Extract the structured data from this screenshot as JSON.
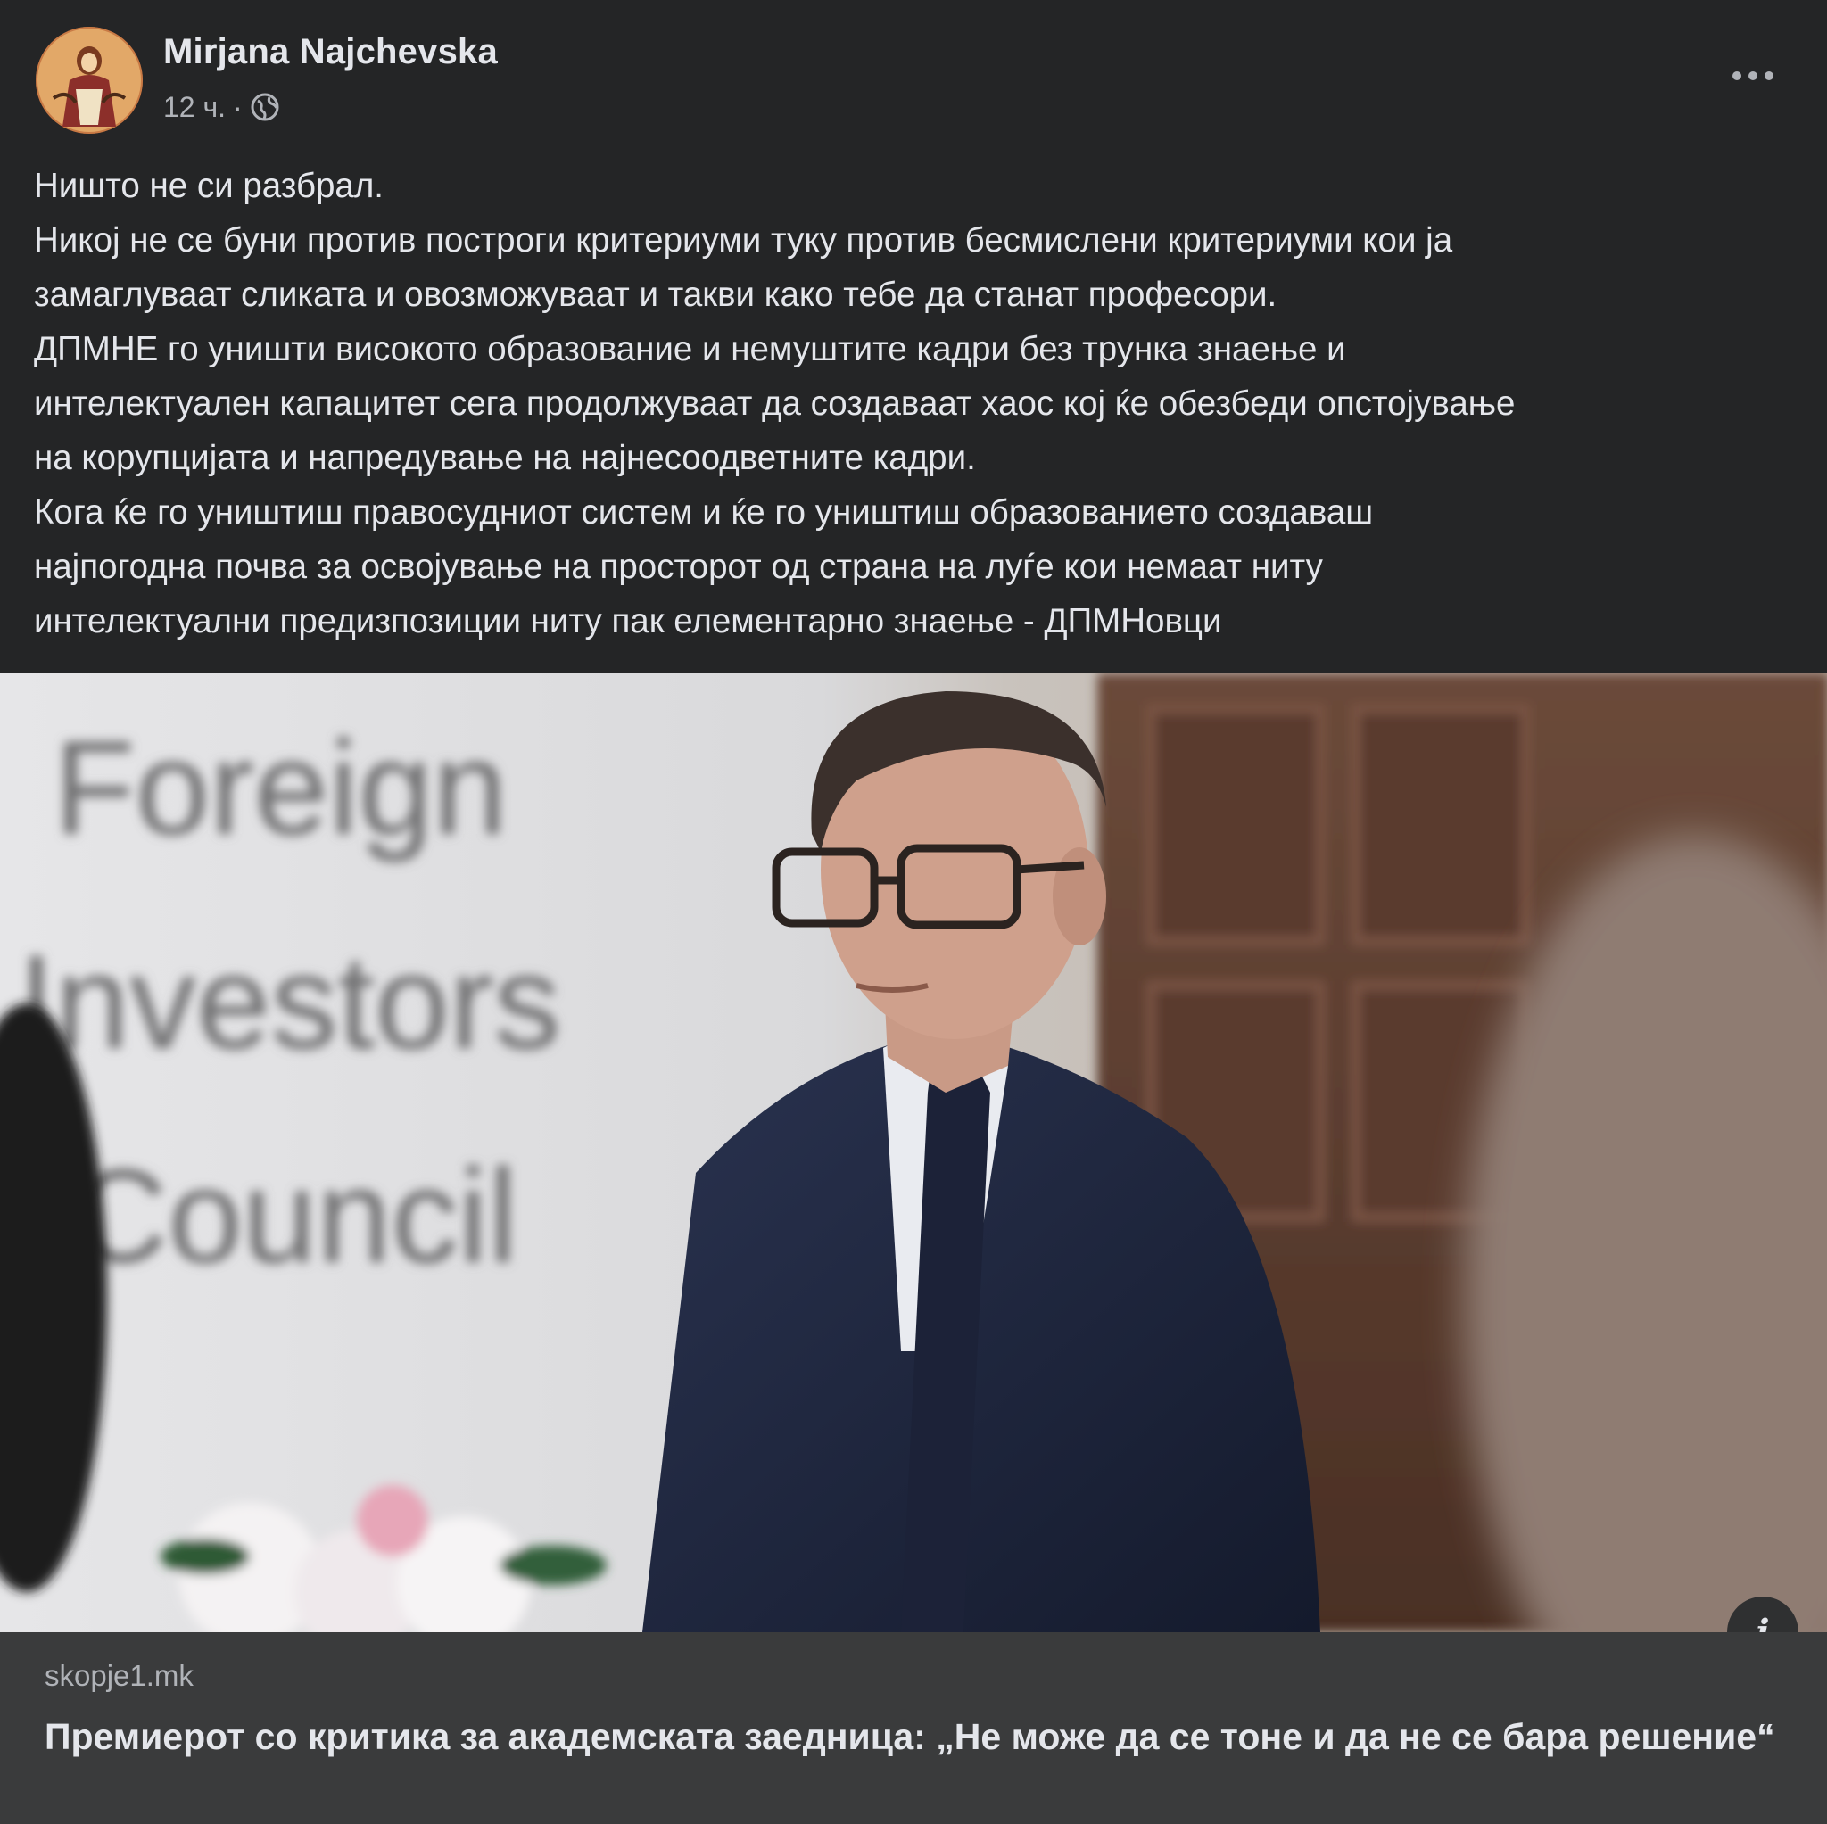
{
  "header": {
    "author_name": "Mirjana Najchevska",
    "timestamp": "12 ч.",
    "separator": "·",
    "audience_icon": "globe-icon",
    "more_icon": "more-options-icon"
  },
  "post": {
    "lines": [
      "Ништо не си разбрал.",
      "Никој не се буни против построги критериуми туку против бесмислени критериуми кои ја",
      "замаглуваат сликата и овозможуваат и такви како тебе да станат професори.",
      "ДПМНЕ го уништи високото образование и немуштите кадри без трунка знаење и",
      "интелектуален капацитет сега продолжуваат да создаваат хаос кој ќе обезбеди опстојување",
      "на корупцијата и напредување на најнесоодветните кадри.",
      "Кога ќе го уништиш правосудниот систем и ќе го уништиш образованието создаваш",
      "најпогодна почва за освојување на просторот од страна на луѓе кои немаат ниту",
      "интелектуални предизпозиции ниту пак елементарно знаење - ДПМНовци"
    ]
  },
  "photo": {
    "backdrop_text": [
      "Foreign",
      "Investors",
      "Council"
    ],
    "info_label": "i"
  },
  "link_preview": {
    "domain": "skopje1.mk",
    "title": "Премиерот со критика за академската заедница: „Не може да се тоне и да не се бара решение“"
  }
}
